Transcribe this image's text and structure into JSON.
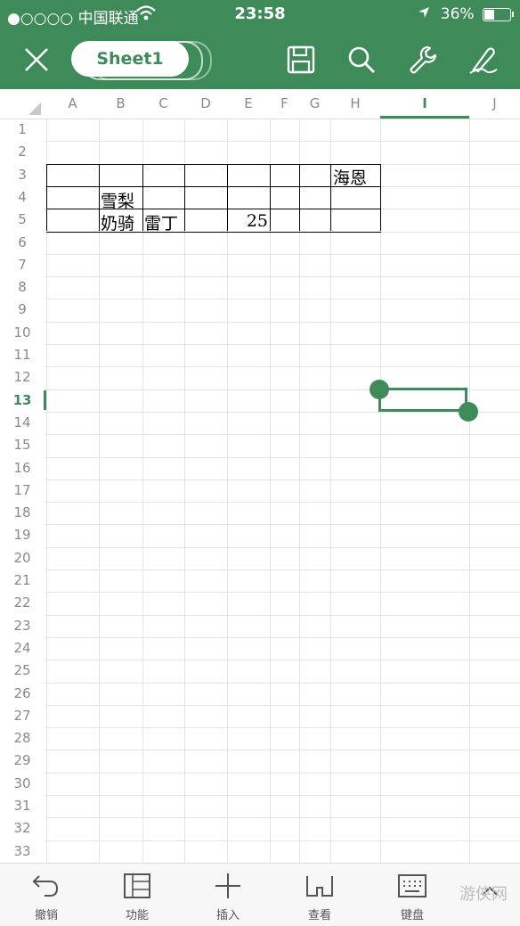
{
  "status_bar": {
    "carrier": "●○○○○ 中国联通",
    "time": "23:58",
    "battery": "36%"
  },
  "toolbar": {
    "sheet_name": "Sheet1",
    "icons": [
      "close-icon",
      "save-icon",
      "search-icon",
      "wrench-icon",
      "pen-icon"
    ],
    "accent_color": "#3e8a59"
  },
  "grid": {
    "columns": [
      "A",
      "B",
      "C",
      "D",
      "E",
      "F",
      "G",
      "H",
      "I",
      "J"
    ],
    "selected_column": "I",
    "rows": [
      "1",
      "2",
      "3",
      "4",
      "5",
      "6",
      "7",
      "8",
      "9",
      "10",
      "11",
      "12",
      "13",
      "14",
      "15",
      "16",
      "17",
      "18",
      "19",
      "20",
      "21",
      "22",
      "23",
      "24",
      "25",
      "26",
      "27",
      "28",
      "29",
      "30",
      "31",
      "32",
      "33"
    ],
    "selected_row": "13",
    "selected_cell": "I13",
    "cells": {
      "H3": "海恩",
      "B4": "雪梨",
      "B5": "奶骑",
      "C5": "雷丁",
      "E5": "25"
    }
  },
  "bottom_bar": {
    "buttons": [
      {
        "label": "撤销",
        "icon": "undo-icon"
      },
      {
        "label": "功能",
        "icon": "panel-icon"
      },
      {
        "label": "插入",
        "icon": "plus-icon"
      },
      {
        "label": "查看",
        "icon": "glasses-icon"
      },
      {
        "label": "键盘",
        "icon": "keyboard-icon"
      }
    ],
    "watermark": "游侠网"
  }
}
